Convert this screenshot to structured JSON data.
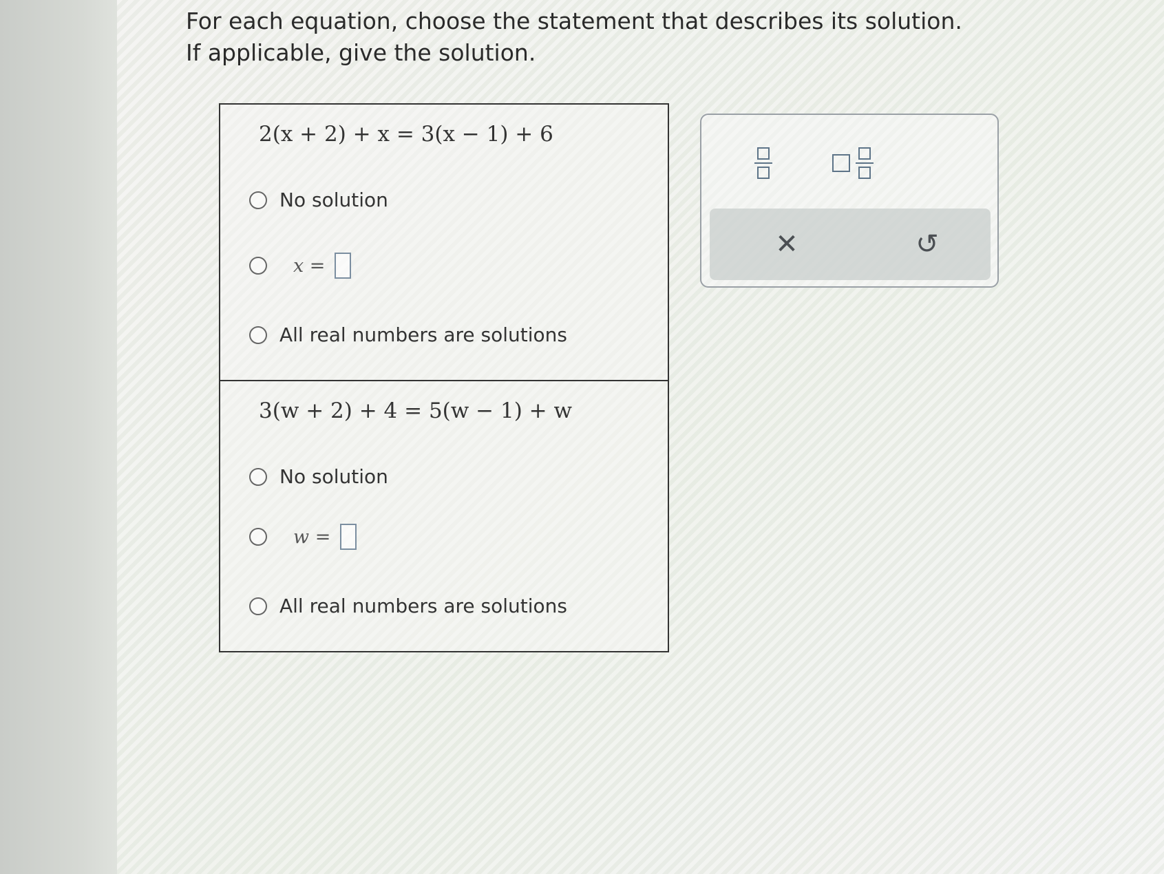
{
  "prompt": {
    "line1": "For each equation, choose the statement that describes its solution.",
    "line2": "If applicable, give the solution."
  },
  "questions": [
    {
      "equation": "2(x + 2) + x = 3(x − 1) + 6",
      "options": {
        "no_solution": "No solution",
        "variable_prefix": "x =",
        "all_real": "All real numbers are solutions"
      }
    },
    {
      "equation": "3(w + 2) + 4 = 5(w − 1) + w",
      "options": {
        "no_solution": "No solution",
        "variable_prefix": "w =",
        "all_real": "All real numbers are solutions"
      }
    }
  ],
  "toolbox": {
    "fraction_icon": "fraction-icon",
    "mixed_number_icon": "mixed-number-icon",
    "clear_glyph": "✕",
    "undo_glyph": "↺"
  },
  "colors": {
    "text": "#2a2a2a",
    "box_border": "#7b8ea0",
    "tool_icon": "#5d7488"
  }
}
